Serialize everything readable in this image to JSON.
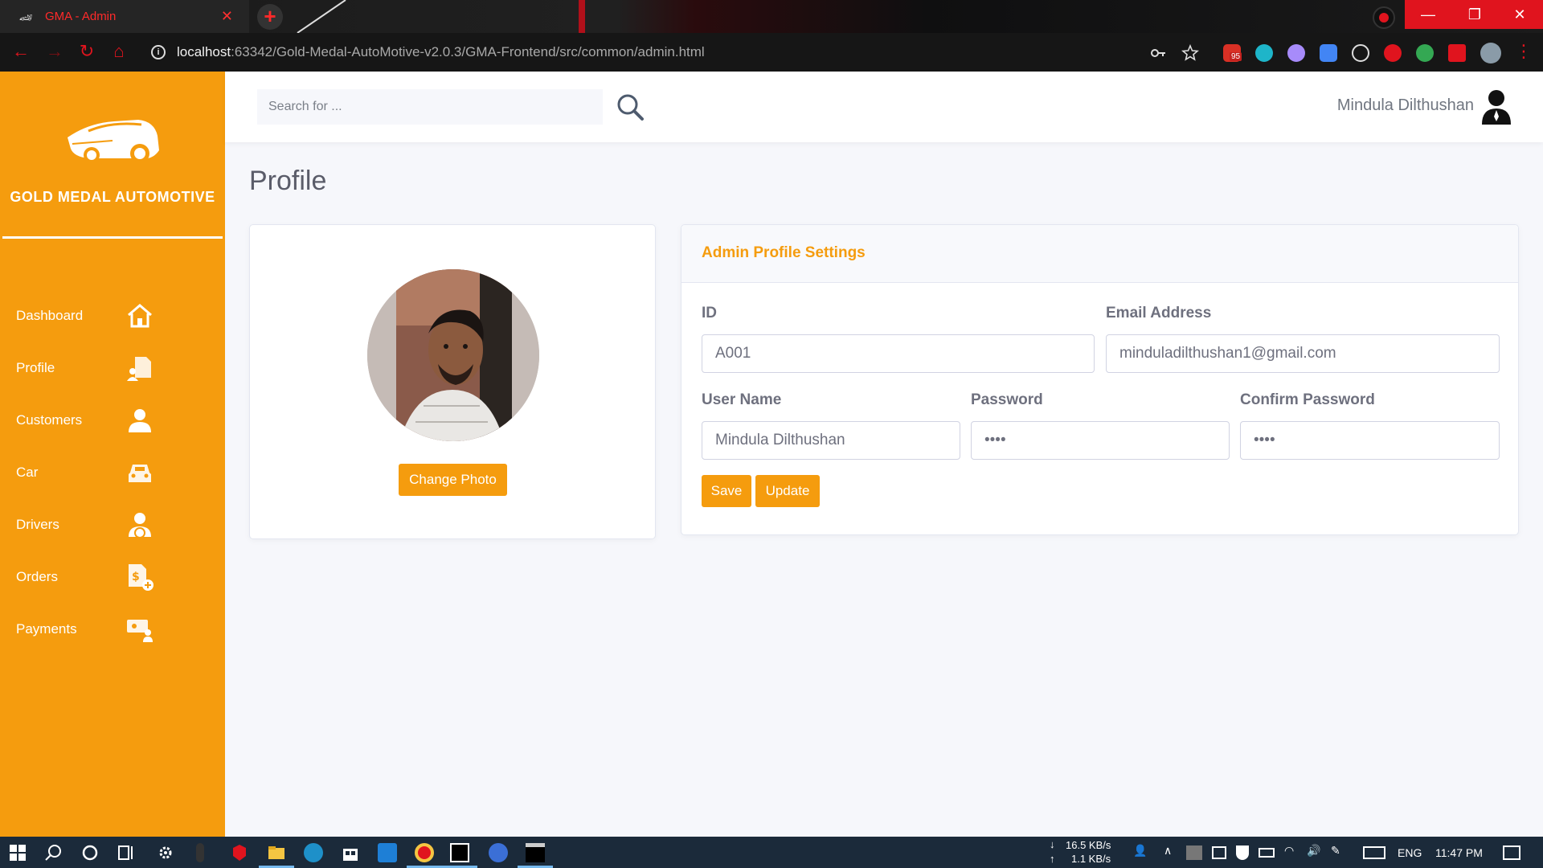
{
  "browser": {
    "tab_title": "GMA - Admin",
    "url_host": "localhost",
    "url_path": ":63342/Gold-Medal-AutoMotive-v2.0.3/GMA-Frontend/src/common/admin.html",
    "gmail_badge": "95"
  },
  "sidebar": {
    "brand": "GOLD MEDAL AUTOMOTIVE",
    "items": [
      {
        "label": "Dashboard",
        "icon": "home-icon"
      },
      {
        "label": "Profile",
        "icon": "profile-file-icon"
      },
      {
        "label": "Customers",
        "icon": "user-icon"
      },
      {
        "label": "Car",
        "icon": "car-icon"
      },
      {
        "label": "Drivers",
        "icon": "driver-icon"
      },
      {
        "label": "Orders",
        "icon": "order-dollar-icon"
      },
      {
        "label": "Payments",
        "icon": "payment-icon"
      }
    ]
  },
  "header": {
    "search_placeholder": "Search for ...",
    "user_name": "Mindula Dilthushan"
  },
  "page": {
    "title": "Profile",
    "change_photo": "Change Photo"
  },
  "settings": {
    "title": "Admin Profile Settings",
    "id_label": "ID",
    "id_value": "A001",
    "email_label": "Email Address",
    "email_value": "minduladilthushan1@gmail.com",
    "username_label": "User Name",
    "username_value": "Mindula Dilthushan",
    "password_label": "Password",
    "password_value": "1234",
    "confirm_label": "Confirm Password",
    "confirm_value": "1234",
    "save": "Save",
    "update": "Update"
  },
  "taskbar": {
    "download_speed": "16.5 KB/s",
    "upload_speed": "1.1 KB/s",
    "language": "ENG",
    "time": "11:47 PM"
  },
  "colors": {
    "accent": "#f59c0e",
    "chrome_red": "#e0141e",
    "taskbar": "#1b2a3a"
  }
}
